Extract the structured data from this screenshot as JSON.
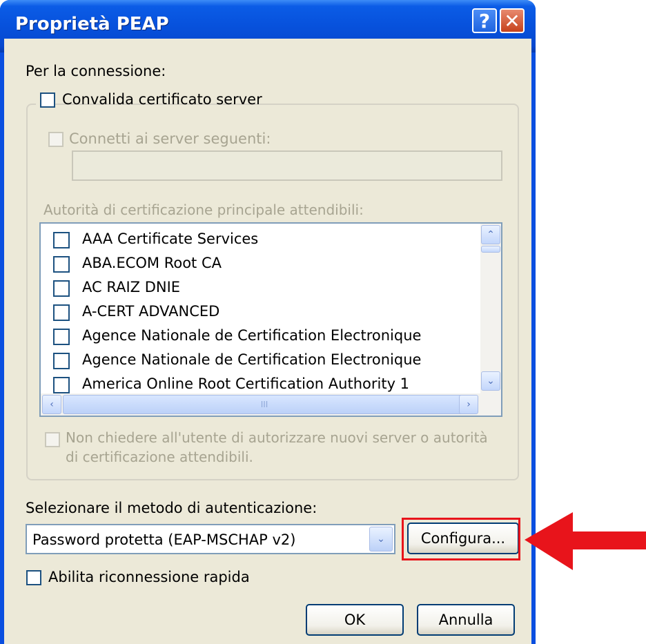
{
  "window": {
    "title": "Proprietà PEAP",
    "help_glyph": "?",
    "close_glyph": "✕"
  },
  "connection": {
    "label": "Per la connessione:",
    "validate_cert_label": "Convalida certificato server",
    "connect_servers_label": "Connetti ai server seguenti:",
    "servers_value": "",
    "trusted_roots_label": "Autorità di certificazione principale attendibili:"
  },
  "certificates": [
    {
      "label": "AAA Certificate Services",
      "checked": false
    },
    {
      "label": "ABA.ECOM Root CA",
      "checked": false
    },
    {
      "label": "AC RAIZ DNIE",
      "checked": false
    },
    {
      "label": "A-CERT ADVANCED",
      "checked": false
    },
    {
      "label": "Agence Nationale de Certification Electronique",
      "checked": false
    },
    {
      "label": "Agence Nationale de Certification Electronique",
      "checked": false
    },
    {
      "label": "America Online Root Certification Authority 1",
      "checked": false
    }
  ],
  "no_prompt_label_line1": "Non chiedere all'utente di autorizzare nuovi server o autorità",
  "no_prompt_label_line2": "di certificazione attendibili.",
  "auth": {
    "label": "Selezionare il metodo di autenticazione:",
    "selected_method": "Password protetta (EAP-MSCHAP v2)",
    "configure_label": "Configura..."
  },
  "fast_reconnect_label": "Abilita riconnessione rapida",
  "buttons": {
    "ok": "OK",
    "cancel": "Annulla"
  },
  "icons": {
    "scroll_up": "⌃",
    "scroll_down": "⌄",
    "scroll_left": "‹",
    "scroll_right": "›",
    "grip": "III",
    "dropdown": "⌄"
  },
  "colors": {
    "titlebar": "#0751dc",
    "dialog_bg": "#ece9d8",
    "highlight": "#e8141b"
  }
}
